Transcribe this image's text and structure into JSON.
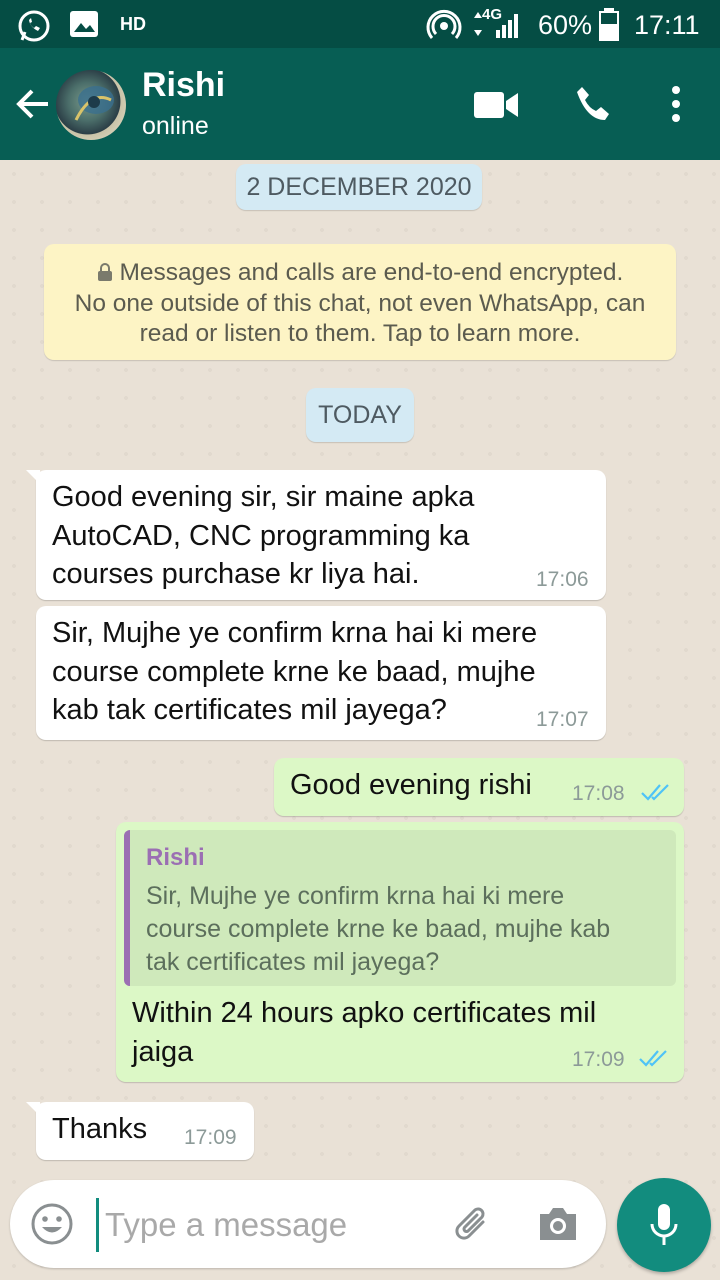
{
  "status_bar": {
    "hd": "HD",
    "network": "4G",
    "battery": "60%",
    "time": "17:11"
  },
  "header": {
    "contact_name": "Rishi",
    "contact_status": "online"
  },
  "dates": {
    "first": "2 DECEMBER 2020",
    "today": "TODAY"
  },
  "encryption_notice": {
    "line1": "Messages and calls are end-to-end encrypted.",
    "line2": "No one outside of this chat, not even WhatsApp, can",
    "line3": "read or listen to them. Tap to learn more."
  },
  "messages": [
    {
      "direction": "in",
      "lines": [
        "Good evening sir, sir maine apka",
        "AutoCAD, CNC programming ka",
        "courses purchase kr liya hai."
      ],
      "time": "17:06"
    },
    {
      "direction": "in",
      "lines": [
        "Sir, Mujhe ye confirm krna hai ki mere",
        "course complete krne ke baad, mujhe",
        "kab tak certificates mil jayega?"
      ],
      "time": "17:07"
    },
    {
      "direction": "out",
      "lines": [
        "Good evening rishi"
      ],
      "time": "17:08",
      "status": "read"
    },
    {
      "direction": "out",
      "quote": {
        "author": "Rishi",
        "lines": [
          "Sir, Mujhe ye confirm krna hai ki mere",
          "course complete krne ke baad, mujhe kab",
          "tak certificates mil jayega?"
        ]
      },
      "lines": [
        "Within 24 hours apko certificates mil",
        "jaiga"
      ],
      "time": "17:09",
      "status": "read"
    },
    {
      "direction": "in",
      "lines": [
        "Thanks"
      ],
      "time": "17:09"
    }
  ],
  "composer": {
    "placeholder": "Type a message"
  },
  "colors": {
    "header": "#075e54",
    "status_bar": "#054d44",
    "outgoing": "#dcf8c6",
    "incoming": "#ffffff",
    "read_ticks": "#4fc3f7",
    "fab": "#128c7e"
  }
}
